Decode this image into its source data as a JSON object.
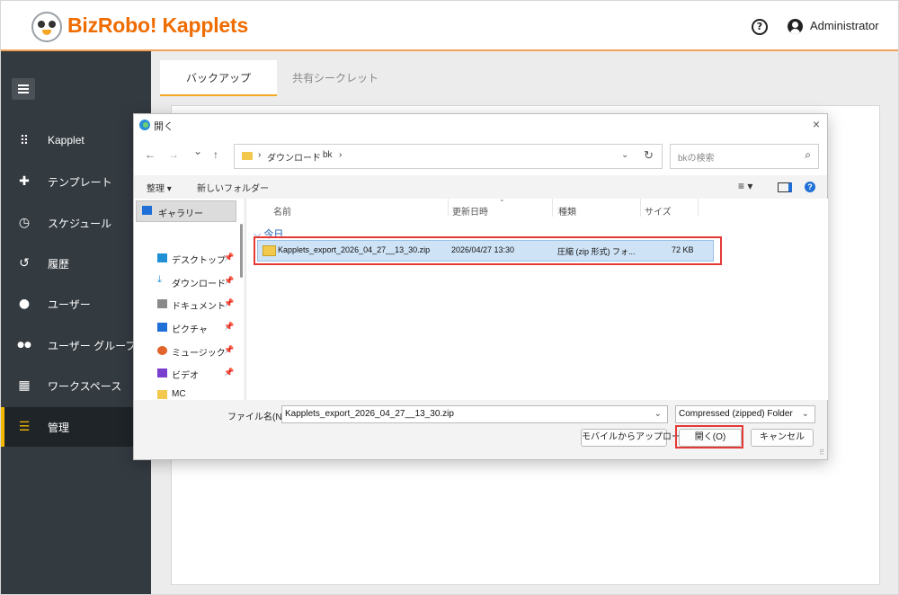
{
  "app": {
    "brand": "BizRobo! Kapplets",
    "user": "Administrator",
    "help_icon": "?"
  },
  "sidebar": {
    "items": [
      {
        "label": "Kapplet",
        "icon": "grid-icon",
        "glyph": "⠿"
      },
      {
        "label": "テンプレート",
        "icon": "puzzle-icon",
        "glyph": "✚"
      },
      {
        "label": "スケジュール",
        "icon": "clock-icon",
        "glyph": "◷"
      },
      {
        "label": "履歴",
        "icon": "history-icon",
        "glyph": "↺"
      },
      {
        "label": "ユーザー",
        "icon": "user-icon",
        "glyph": "●"
      },
      {
        "label": "ユーザー グループ",
        "icon": "group-icon",
        "glyph": "●●"
      },
      {
        "label": "ワークスペース",
        "icon": "workspace-icon",
        "glyph": "▦"
      },
      {
        "label": "管理",
        "icon": "list-icon",
        "glyph": "☰",
        "active": true
      }
    ]
  },
  "main": {
    "tabs": [
      {
        "label": "バックアップ",
        "active": true
      },
      {
        "label": "共有シークレット",
        "active": false
      }
    ]
  },
  "dialog": {
    "title": "開く",
    "close": "×",
    "nav": {
      "back": "←",
      "forward": "→",
      "recent": "⌄",
      "up": "↑"
    },
    "address": {
      "crumbs": [
        "›",
        "ダウンロード",
        "›",
        "bk",
        "›"
      ],
      "dropdown": "⌄",
      "refresh": "↻"
    },
    "search_placeholder": "bkの検索",
    "search_glyph": "⌕",
    "cmd": {
      "organize": "整理 ▾",
      "new_folder": "新しいフォルダー",
      "view": "≡ ▾"
    },
    "nav_pane": {
      "gallery": "ギャラリー",
      "items": [
        {
          "label": "デスクトップ",
          "icon": "desktop-icon",
          "color": "#1f8fd6",
          "pin": "📌"
        },
        {
          "label": "ダウンロード",
          "icon": "download-icon",
          "color": "#1f8fd6",
          "pin": "📌"
        },
        {
          "label": "ドキュメント",
          "icon": "document-icon",
          "color": "#8a8a8a",
          "pin": "📌"
        },
        {
          "label": "ピクチャ",
          "icon": "picture-icon",
          "color": "#1f6fd6",
          "pin": "📌"
        },
        {
          "label": "ミュージック",
          "icon": "music-icon",
          "color": "#e0642b",
          "pin": "📌"
        },
        {
          "label": "ビデオ",
          "icon": "video-icon",
          "color": "#7b3fd0",
          "pin": "📌"
        },
        {
          "label": "MC",
          "icon": "folder-icon",
          "color": "#f2c94c",
          "pin": ""
        }
      ]
    },
    "columns": [
      "名前",
      "更新日時",
      "種類",
      "サイズ"
    ],
    "group": "⌵ 今日",
    "file": {
      "name": "Kapplets_export_2026_04_27__13_30.zip",
      "modified": "2026/04/27 13:30",
      "type": "圧縮 (zip 形式) フォ...",
      "size": "72 KB"
    },
    "filename_label": "ファイル名(N):",
    "filename_value": "Kapplets_export_2026_04_27__13_30.zip",
    "filename_dropdown": "⌄",
    "filetype": "Compressed (zipped) Folder",
    "filetype_dropdown": "⌄",
    "buttons": {
      "upload": "モバイルからアップロード",
      "open": "開く(O)",
      "cancel": "キャンセル"
    },
    "resize_grip": "⠿"
  },
  "colors": {
    "accent": "#f5a623",
    "brand": "#ef6c00",
    "highlight": "#e53935",
    "sidebar": "#333a40"
  }
}
